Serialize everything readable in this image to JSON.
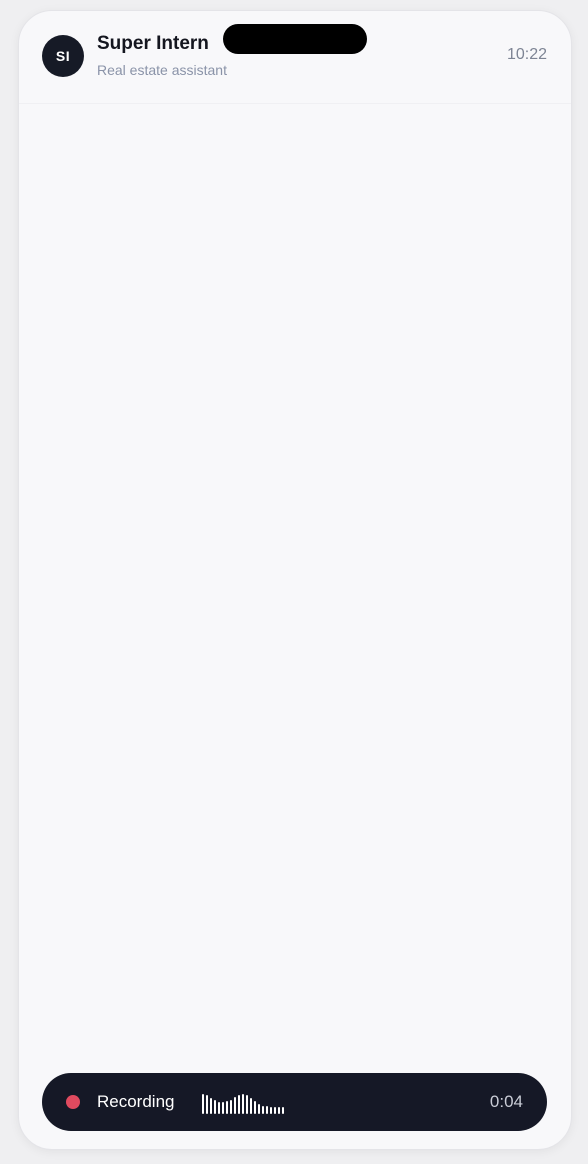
{
  "header": {
    "avatar_initials": "SI",
    "title": "Super Intern",
    "subtitle": "Real estate assistant",
    "time": "10:22"
  },
  "recording": {
    "label": "Recording",
    "elapsed": "0:04",
    "levels": [
      0.85,
      0.8,
      0.65,
      0.6,
      0.5,
      0.5,
      0.55,
      0.6,
      0.7,
      0.8,
      0.85,
      0.8,
      0.65,
      0.55,
      0.4,
      0.35,
      0.35,
      0.3,
      0.3,
      0.3,
      0.3
    ],
    "indicator_color": "#e04a5f"
  },
  "colors": {
    "accent_dark": "#151826",
    "background": "#f8f8fa"
  }
}
